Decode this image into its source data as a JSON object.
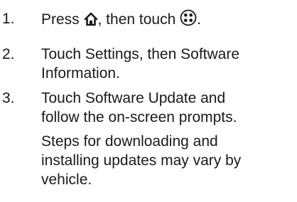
{
  "steps": [
    {
      "number": "1.",
      "text_before_home": "Press ",
      "text_between": ", then touch ",
      "text_after": ".",
      "icons": [
        "home-icon",
        "apps-icon"
      ]
    },
    {
      "number": "2.",
      "line1": "Touch Settings, then Software",
      "line2": "Information."
    },
    {
      "number": "3.",
      "line1": "Touch Software Update and",
      "line2": "follow the on-screen prompts."
    }
  ],
  "note": {
    "line1": "Steps for downloading and",
    "line2": "installing updates may vary by",
    "line3": "vehicle."
  }
}
